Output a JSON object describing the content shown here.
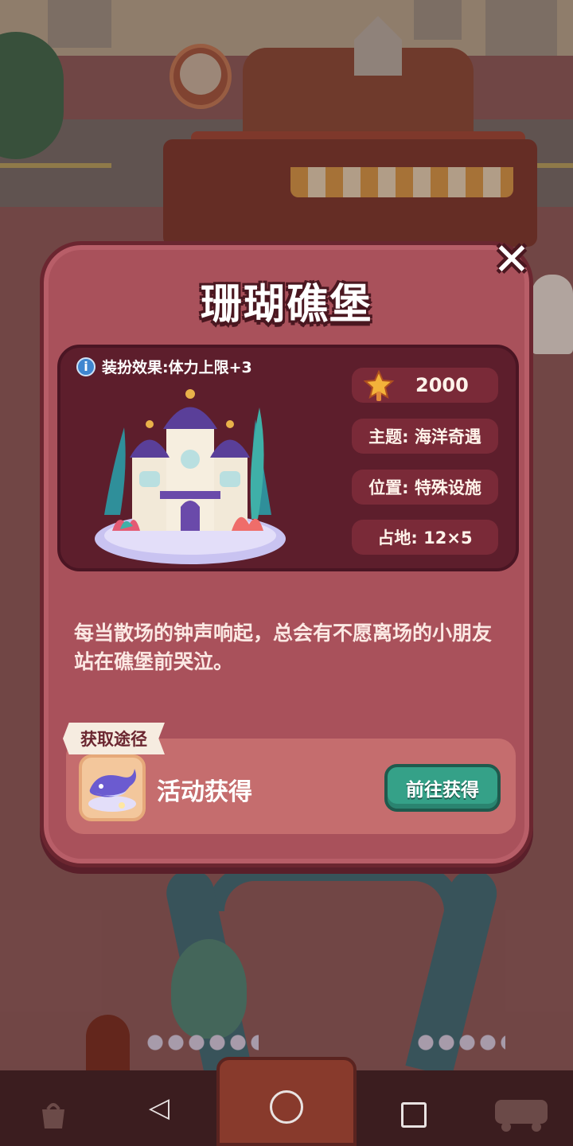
{
  "dialog": {
    "title": "珊瑚礁堡",
    "close_symbol": "✕",
    "effect": "装扮效果:体力上限+3",
    "price": "2000",
    "theme": "主题: 海洋奇遇",
    "location": "位置: 特殊设施",
    "footprint": "占地: 12×5",
    "description": "每当散场的钟声响起，总会有不愿离场的小朋友站在礁堡前哭泣。",
    "obtain_tag": "获取途径",
    "source": "活动获得",
    "goto_button": "前往获得"
  },
  "icons": {
    "info": "i",
    "price_star": "star-wand-icon",
    "source": "whale-icon",
    "back": "◁"
  },
  "colors": {
    "modal_bg": "#a9515b",
    "panel_bg": "#5d1e2c",
    "button_green": "#35a188"
  }
}
